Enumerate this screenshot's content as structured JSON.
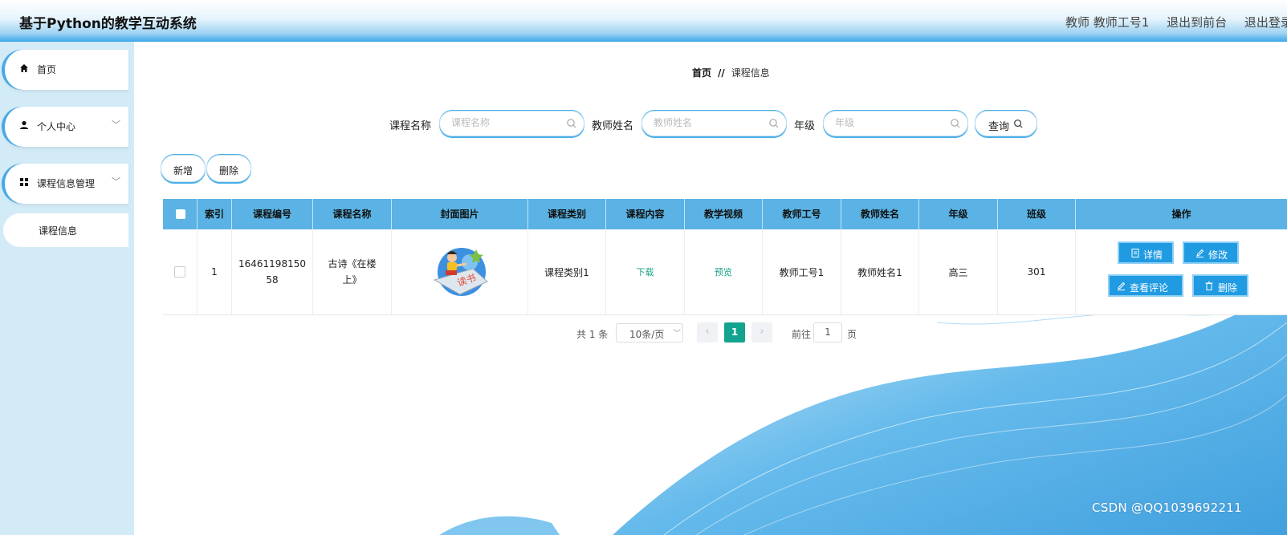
{
  "header": {
    "app_title": "基于Python的教学互动系统",
    "user_label": "教师 教师工号1",
    "front_link": "退出到前台",
    "logout_link": "退出登录"
  },
  "sidebar": {
    "items": [
      {
        "label": "首页",
        "icon": "home-icon"
      },
      {
        "label": "个人中心",
        "icon": "user-icon"
      },
      {
        "label": "课程信息管理",
        "icon": "grid-icon"
      }
    ],
    "sub_item": "课程信息"
  },
  "breadcrumb": {
    "home": "首页",
    "separator": "//",
    "current": "课程信息"
  },
  "search": {
    "course_name_label": "课程名称",
    "course_name_placeholder": "课程名称",
    "teacher_name_label": "教师姓名",
    "teacher_name_placeholder": "教师姓名",
    "grade_label": "年级",
    "grade_placeholder": "年级",
    "query_button": "查询"
  },
  "actions": {
    "add": "新增",
    "delete": "删除"
  },
  "table": {
    "headers": [
      "索引",
      "课程编号",
      "课程名称",
      "封面图片",
      "课程类别",
      "课程内容",
      "教学视频",
      "教师工号",
      "教师姓名",
      "年级",
      "班级",
      "操作"
    ],
    "rows": [
      {
        "index": "1",
        "course_id_line1": "16461198150",
        "course_id_line2": "58",
        "course_name_line1": "古诗《在楼",
        "course_name_line2": "上》",
        "category": "课程类别1",
        "content_link": "下载",
        "video_link": "预览",
        "teacher_id": "教师工号1",
        "teacher_name": "教师姓名1",
        "grade": "高三",
        "class": "301",
        "buttons": {
          "detail": "详情",
          "edit": "修改",
          "comments": "查看评论",
          "delete": "删除"
        }
      }
    ]
  },
  "pagination": {
    "total": "共 1 条",
    "page_size": "10条/页",
    "current_page": "1",
    "goto_label": "前往",
    "goto_value": "1",
    "page_suffix": "页"
  },
  "watermark": "CSDN @QQ1039692211",
  "colors": {
    "accent": "#209be2",
    "header_row": "#5ab3e4",
    "sidebar_bg": "#d3ebf7",
    "active_page": "#13a38f"
  }
}
